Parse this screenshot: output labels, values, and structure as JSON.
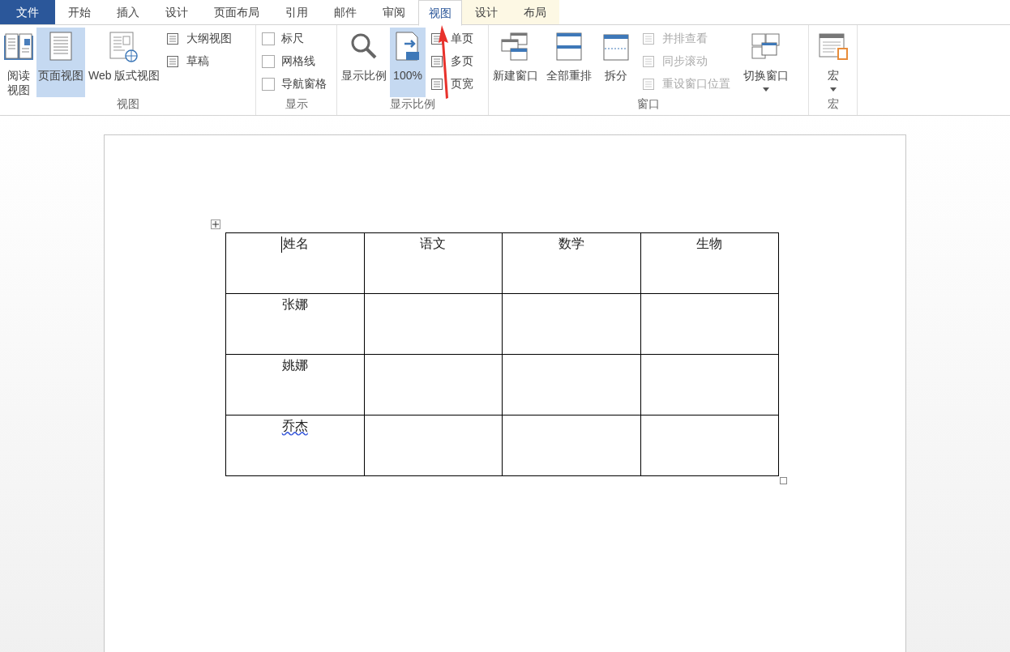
{
  "tabs": [
    {
      "label": "文件",
      "kind": "file",
      "selected": false
    },
    {
      "label": "开始",
      "kind": "normal",
      "selected": false
    },
    {
      "label": "插入",
      "kind": "normal",
      "selected": false
    },
    {
      "label": "设计",
      "kind": "normal",
      "selected": false
    },
    {
      "label": "页面布局",
      "kind": "normal",
      "selected": false
    },
    {
      "label": "引用",
      "kind": "normal",
      "selected": false
    },
    {
      "label": "邮件",
      "kind": "normal",
      "selected": false
    },
    {
      "label": "审阅",
      "kind": "normal",
      "selected": false
    },
    {
      "label": "视图",
      "kind": "normal",
      "selected": true
    },
    {
      "label": "设计",
      "kind": "contextual",
      "selected": false
    },
    {
      "label": "布局",
      "kind": "contextual",
      "selected": false
    }
  ],
  "ribbon_groups": [
    {
      "label": "视图",
      "items": [
        {
          "kind": "large",
          "label": "阅读视图",
          "selected": false
        },
        {
          "kind": "large",
          "label": "页面视图",
          "selected": true
        },
        {
          "kind": "large",
          "label": "Web 版式视图",
          "selected": false
        },
        {
          "kind": "small",
          "label": "大纲视图",
          "disabled": false
        },
        {
          "kind": "small",
          "label": "草稿",
          "disabled": false
        }
      ]
    },
    {
      "label": "显示",
      "items": [
        {
          "kind": "check",
          "label": "标尺",
          "checked": false
        },
        {
          "kind": "check",
          "label": "网格线",
          "checked": false
        },
        {
          "kind": "check",
          "label": "导航窗格",
          "checked": false
        }
      ]
    },
    {
      "label": "显示比例",
      "items": [
        {
          "kind": "large",
          "label": "显示比例",
          "selected": false
        },
        {
          "kind": "large",
          "label": "100%",
          "selected": true
        },
        {
          "kind": "small",
          "label": "单页",
          "disabled": false
        },
        {
          "kind": "small",
          "label": "多页",
          "disabled": false
        },
        {
          "kind": "small",
          "label": "页宽",
          "disabled": false
        }
      ]
    },
    {
      "label": "窗口",
      "items": [
        {
          "kind": "large",
          "label": "新建窗口",
          "selected": false
        },
        {
          "kind": "large",
          "label": "全部重排",
          "selected": false
        },
        {
          "kind": "large",
          "label": "拆分",
          "selected": false
        },
        {
          "kind": "small",
          "label": "并排查看",
          "disabled": true
        },
        {
          "kind": "small",
          "label": "同步滚动",
          "disabled": true
        },
        {
          "kind": "small",
          "label": "重设窗口位置",
          "disabled": true
        },
        {
          "kind": "dropdown",
          "label": "切换窗口"
        }
      ]
    },
    {
      "label": "宏",
      "items": [
        {
          "kind": "dropdown",
          "label": "宏"
        }
      ]
    }
  ],
  "table": {
    "rows": [
      [
        {
          "text": "姓名",
          "caret": true
        },
        {
          "text": "语文"
        },
        {
          "text": "数学"
        },
        {
          "text": "生物"
        }
      ],
      [
        {
          "text": "张娜"
        },
        {
          "text": ""
        },
        {
          "text": ""
        },
        {
          "text": ""
        }
      ],
      [
        {
          "text": "姚娜"
        },
        {
          "text": ""
        },
        {
          "text": ""
        },
        {
          "text": ""
        }
      ],
      [
        {
          "text": "乔杰",
          "misspelled": true
        },
        {
          "text": ""
        },
        {
          "text": ""
        },
        {
          "text": ""
        }
      ]
    ]
  }
}
